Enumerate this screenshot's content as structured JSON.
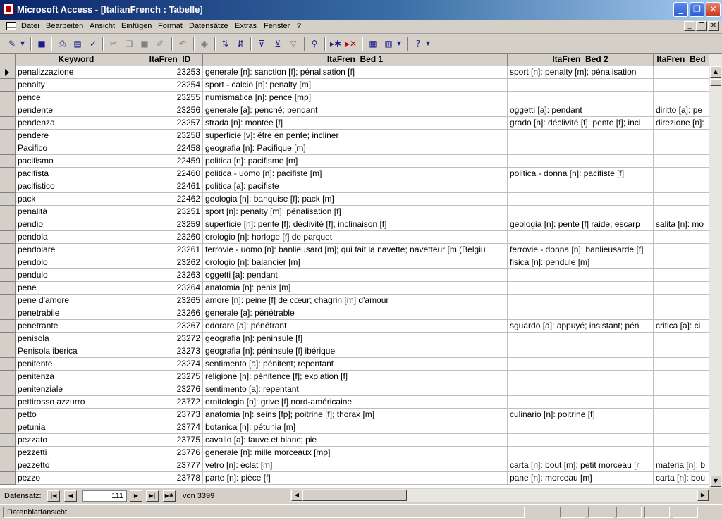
{
  "window": {
    "title": "Microsoft Access - [ItalianFrench : Tabelle]"
  },
  "menu": [
    "Datei",
    "Bearbeiten",
    "Ansicht",
    "Einfügen",
    "Format",
    "Datensätze",
    "Extras",
    "Fenster",
    "?"
  ],
  "columns": [
    "Keyword",
    "ItaFren_ID",
    "ItaFren_Bed 1",
    "ItaFren_Bed 2",
    "ItaFren_Bed"
  ],
  "rows": [
    {
      "keyword": "penalizzazione",
      "id": "23253",
      "bed1": "generale [n]: sanction [f]; pénalisation [f]",
      "bed2": "sport [n]: penalty [m]; pénalisation",
      "bed3": ""
    },
    {
      "keyword": "penalty",
      "id": "23254",
      "bed1": "sport - calcio [n]: penalty [m]",
      "bed2": "",
      "bed3": ""
    },
    {
      "keyword": "pence",
      "id": "23255",
      "bed1": "numismatica [n]: pence [mp]",
      "bed2": "",
      "bed3": ""
    },
    {
      "keyword": "pendente",
      "id": "23256",
      "bed1": "generale [a]: penché; pendant",
      "bed2": "oggetti [a]: pendant",
      "bed3": "diritto [a]: pe"
    },
    {
      "keyword": "pendenza",
      "id": "23257",
      "bed1": "strada [n]: montée [f]",
      "bed2": "grado [n]: déclivité [f]; pente [f]; incl",
      "bed3": "direzione [n]:"
    },
    {
      "keyword": "pendere",
      "id": "23258",
      "bed1": "superficie [v]: être en pente; incliner",
      "bed2": "",
      "bed3": ""
    },
    {
      "keyword": "Pacifico",
      "id": "22458",
      "bed1": "geografia [n]: Pacifique [m]",
      "bed2": "",
      "bed3": ""
    },
    {
      "keyword": "pacifismo",
      "id": "22459",
      "bed1": "politica [n]: pacifisme [m]",
      "bed2": "",
      "bed3": ""
    },
    {
      "keyword": "pacifista",
      "id": "22460",
      "bed1": "politica - uomo [n]: pacifiste [m]",
      "bed2": "politica - donna [n]: pacifiste [f]",
      "bed3": ""
    },
    {
      "keyword": "pacifistico",
      "id": "22461",
      "bed1": "politica [a]: pacifiste",
      "bed2": "",
      "bed3": ""
    },
    {
      "keyword": "pack",
      "id": "22462",
      "bed1": "geologia [n]: banquise [f]; pack [m]",
      "bed2": "",
      "bed3": ""
    },
    {
      "keyword": "penalità",
      "id": "23251",
      "bed1": "sport [n]: penalty [m]; pénalisation [f]",
      "bed2": "",
      "bed3": ""
    },
    {
      "keyword": "pendio",
      "id": "23259",
      "bed1": "superficie [n]: pente [f]; déclivité [f]; inclinaison [f]",
      "bed2": "geologia [n]: pente [f] raide; escarp",
      "bed3": "salita [n]: mo"
    },
    {
      "keyword": "pendola",
      "id": "23260",
      "bed1": "orologio [n]: horloge [f] de parquet",
      "bed2": "",
      "bed3": ""
    },
    {
      "keyword": "pendolare",
      "id": "23261",
      "bed1": "ferrovie - uomo [n]: banlieusard [m]; qui fait la navette; navetteur [m (Belgiu",
      "bed2": "ferrovie - donna [n]: banlieusarde [f]",
      "bed3": ""
    },
    {
      "keyword": "pendolo",
      "id": "23262",
      "bed1": "orologio [n]: balancier [m]",
      "bed2": "fisica [n]: pendule [m]",
      "bed3": ""
    },
    {
      "keyword": "pendulo",
      "id": "23263",
      "bed1": "oggetti [a]: pendant",
      "bed2": "",
      "bed3": ""
    },
    {
      "keyword": "pene",
      "id": "23264",
      "bed1": "anatomia [n]: pénis [m]",
      "bed2": "",
      "bed3": ""
    },
    {
      "keyword": "pene d'amore",
      "id": "23265",
      "bed1": "amore [n]: peine [f] de cœur; chagrin [m] d'amour",
      "bed2": "",
      "bed3": ""
    },
    {
      "keyword": "penetrabile",
      "id": "23266",
      "bed1": "generale [a]: pénétrable",
      "bed2": "",
      "bed3": ""
    },
    {
      "keyword": "penetrante",
      "id": "23267",
      "bed1": "odorare [a]: pénétrant",
      "bed2": "sguardo [a]: appuyé; insistant; pén",
      "bed3": "critica [a]: ci"
    },
    {
      "keyword": "penisola",
      "id": "23272",
      "bed1": "geografia [n]: péninsule [f]",
      "bed2": "",
      "bed3": ""
    },
    {
      "keyword": "Penisola iberica",
      "id": "23273",
      "bed1": "geografia [n]: péninsule [f] ibérique",
      "bed2": "",
      "bed3": ""
    },
    {
      "keyword": "penitente",
      "id": "23274",
      "bed1": "sentimento [a]: pénitent; repentant",
      "bed2": "",
      "bed3": ""
    },
    {
      "keyword": "penitenza",
      "id": "23275",
      "bed1": "religione [n]: pénitence [f]; expiation [f]",
      "bed2": "",
      "bed3": ""
    },
    {
      "keyword": "penitenziale",
      "id": "23276",
      "bed1": "sentimento [a]: repentant",
      "bed2": "",
      "bed3": ""
    },
    {
      "keyword": "pettirosso azzurro",
      "id": "23772",
      "bed1": "ornitologia [n]: grive [f] nord-américaine",
      "bed2": "",
      "bed3": ""
    },
    {
      "keyword": "petto",
      "id": "23773",
      "bed1": "anatomia [n]: seins [fp]; poitrine [f]; thorax [m]",
      "bed2": "culinario [n]: poitrine [f]",
      "bed3": ""
    },
    {
      "keyword": "petunia",
      "id": "23774",
      "bed1": "botanica [n]: pétunia [m]",
      "bed2": "",
      "bed3": ""
    },
    {
      "keyword": "pezzato",
      "id": "23775",
      "bed1": "cavallo [a]: fauve et blanc; pie",
      "bed2": "",
      "bed3": ""
    },
    {
      "keyword": "pezzetti",
      "id": "23776",
      "bed1": "generale [n]: mille morceaux [mp]",
      "bed2": "",
      "bed3": ""
    },
    {
      "keyword": "pezzetto",
      "id": "23777",
      "bed1": "vetro [n]: éclat [m]",
      "bed2": "carta [n]: bout [m]; petit morceau [r",
      "bed3": "materia [n]: b"
    },
    {
      "keyword": "pezzo",
      "id": "23778",
      "bed1": "parte [n]: pièce [f]",
      "bed2": "pane [n]: morceau [m]",
      "bed3": "carta [n]: bou"
    }
  ],
  "nav": {
    "label": "Datensatz:",
    "current": "111",
    "of_text": "von  3399"
  },
  "status": {
    "text": "Datenblattansicht"
  }
}
